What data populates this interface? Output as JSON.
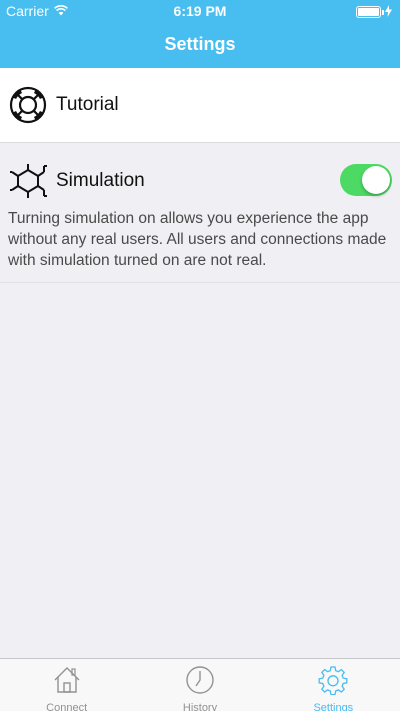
{
  "status_bar": {
    "carrier": "Carrier",
    "time": "6:19 PM"
  },
  "nav": {
    "title": "Settings"
  },
  "tutorial": {
    "label": "Tutorial",
    "icon": "lifebuoy-icon"
  },
  "simulation": {
    "label": "Simulation",
    "icon": "hexagon-network-icon",
    "enabled": true,
    "description": "Turning simulation on allows you experience the app without any real users. All users and connections made with simulation turned on are not real."
  },
  "tabbar": {
    "tabs": [
      {
        "label": "Connect",
        "icon": "house-icon",
        "active": false
      },
      {
        "label": "History",
        "icon": "clock-icon",
        "active": false
      },
      {
        "label": "Settings",
        "icon": "gear-icon",
        "active": true
      }
    ]
  },
  "colors": {
    "accent": "#47bdf0",
    "toggle_on": "#4cd964",
    "background": "#efeff4"
  }
}
